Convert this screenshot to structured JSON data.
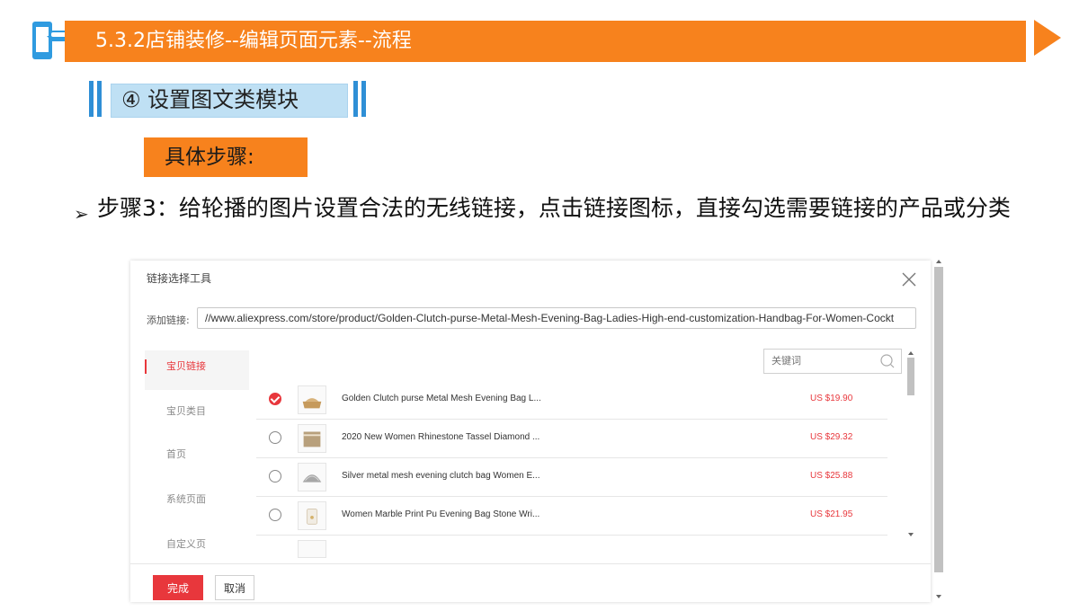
{
  "slide": {
    "header_title": "5.3.2店铺装修--编辑页面元素--流程",
    "section_label": "④ 设置图文类模块",
    "steps_label": "具体步骤:",
    "instruction": "步骤3：给轮播的图片设置合法的无线链接，点击链接图标，直接勾选需要链接的产品或分类",
    "accent_color": "#f7821d",
    "section_color": "#2f8fd6"
  },
  "dialog": {
    "title": "链接选择工具",
    "link_label": "添加链接:",
    "link_value": "//www.aliexpress.com/store/product/Golden-Clutch-purse-Metal-Mesh-Evening-Bag-Ladies-High-end-customization-Handbag-For-Women-Cockt",
    "keyword_placeholder": "关键词",
    "sidebar": [
      {
        "label": "宝贝链接",
        "active": true
      },
      {
        "label": "宝贝类目",
        "active": false
      },
      {
        "label": "首页",
        "active": false
      },
      {
        "label": "系统页面",
        "active": false
      },
      {
        "label": "自定义页",
        "active": false
      }
    ],
    "products": [
      {
        "name": "Golden Clutch purse Metal Mesh Evening Bag L...",
        "price": "US $19.90",
        "selected": true
      },
      {
        "name": "2020 New Women Rhinestone Tassel Diamond ...",
        "price": "US $29.32",
        "selected": false
      },
      {
        "name": "Silver metal mesh evening clutch bag Women E...",
        "price": "US $25.88",
        "selected": false
      },
      {
        "name": "Women Marble Print Pu Evening Bag Stone Wri...",
        "price": "US $21.95",
        "selected": false
      }
    ],
    "ok_label": "完成",
    "cancel_label": "取消"
  }
}
